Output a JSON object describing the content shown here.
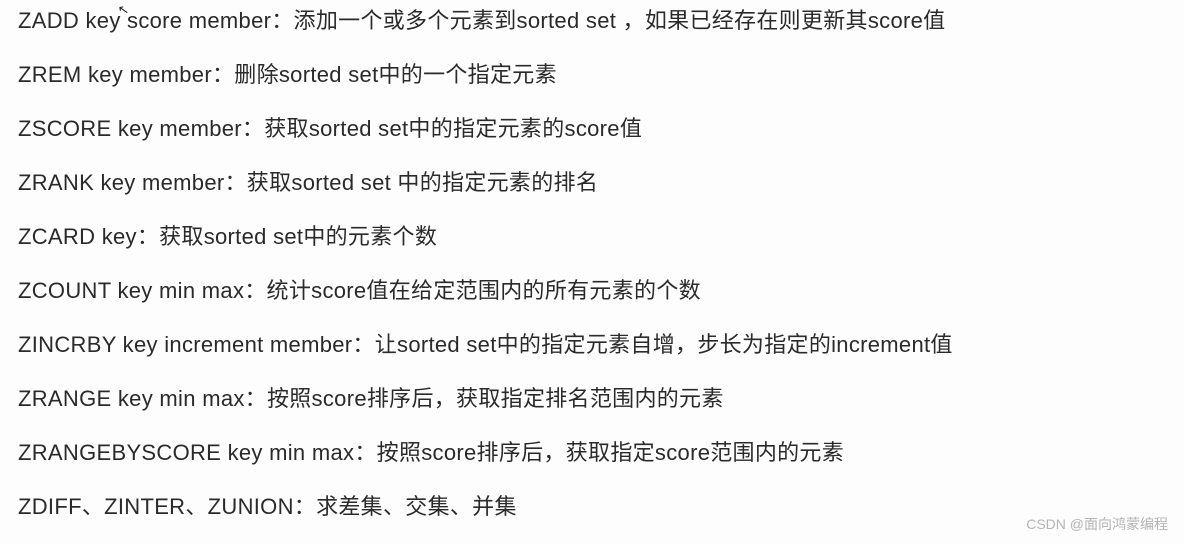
{
  "commands": [
    "ZADD key score member：添加一个或多个元素到sorted set ，如果已经存在则更新其score值",
    "ZREM key member：删除sorted set中的一个指定元素",
    "ZSCORE key member：获取sorted set中的指定元素的score值",
    "ZRANK key member：获取sorted set 中的指定元素的排名",
    "ZCARD key：获取sorted set中的元素个数",
    "ZCOUNT key min max：统计score值在给定范围内的所有元素的个数",
    "ZINCRBY key increment member：让sorted set中的指定元素自增，步长为指定的increment值",
    "ZRANGE key min max：按照score排序后，获取指定排名范围内的元素",
    "ZRANGEBYSCORE key min max：按照score排序后，获取指定score范围内的元素",
    "ZDIFF、ZINTER、ZUNION：求差集、交集、并集"
  ],
  "watermark": "CSDN @面向鸿蒙编程"
}
